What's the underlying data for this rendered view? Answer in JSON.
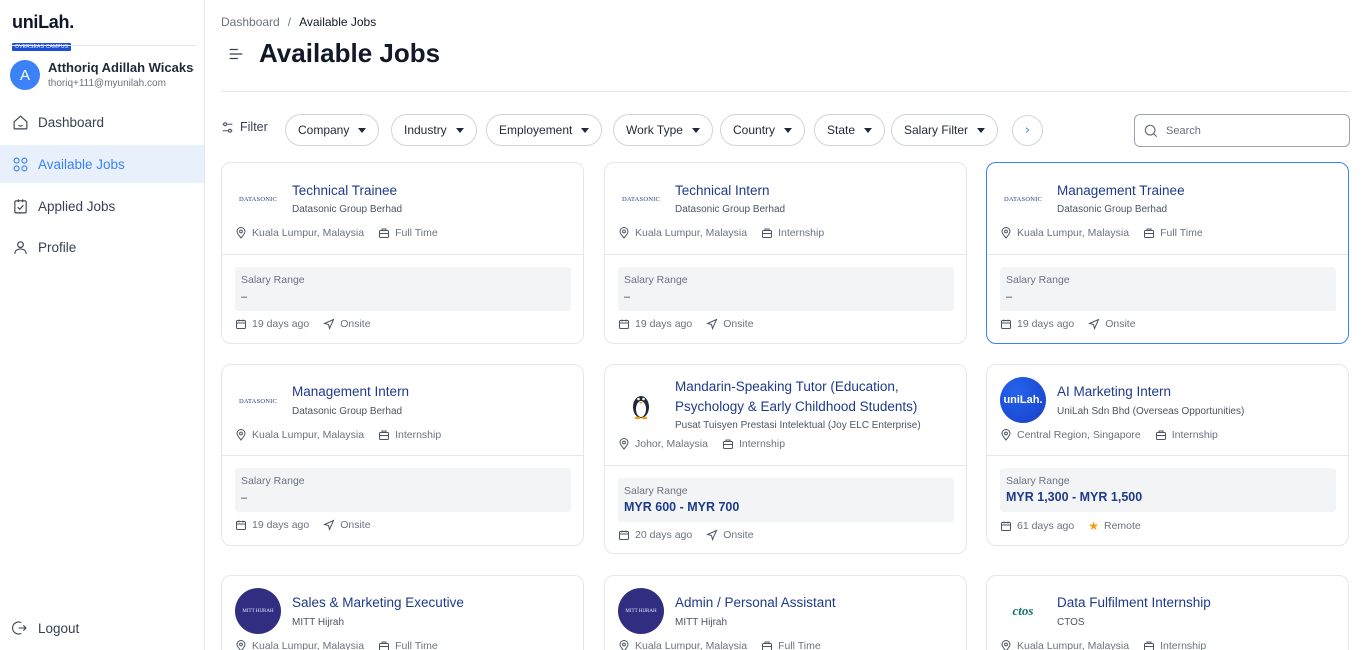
{
  "brand": {
    "name": "uniLah.",
    "tagline": "OVERSEAS CAMPUS"
  },
  "user": {
    "initial": "A",
    "name": "Atthoriq Adillah Wicaksana",
    "email": "thoriq+111@myunilah.com"
  },
  "sidebar": {
    "items": [
      {
        "label": "Dashboard",
        "icon": "home-icon",
        "active": false
      },
      {
        "label": "Available Jobs",
        "icon": "grid-icon",
        "active": true
      },
      {
        "label": "Applied Jobs",
        "icon": "applied-icon",
        "active": false
      },
      {
        "label": "Profile",
        "icon": "person-icon",
        "active": false
      }
    ],
    "logout": "Logout"
  },
  "breadcrumb": {
    "root": "Dashboard",
    "separator": "/",
    "current": "Available Jobs"
  },
  "page": {
    "title": "Available Jobs"
  },
  "filters": {
    "label": "Filter",
    "dropdowns": [
      "Company",
      "Industry",
      "Employement",
      "Work Type",
      "Country",
      "State",
      "Salary Filter"
    ],
    "next": "›"
  },
  "search": {
    "placeholder": "Search"
  },
  "common": {
    "salary_label": "Salary Range"
  },
  "colors": {
    "accent": "#3b82f6",
    "title": "#1e3a8a",
    "active_bg": "#e8f0fb"
  },
  "jobs": [
    {
      "title": "Technical Trainee",
      "company": "Datasonic Group Berhad",
      "logo": "DATASONIC",
      "location": "Kuala Lumpur, Malaysia",
      "type": "Full Time",
      "salary": "–",
      "posted": "19 days ago",
      "mode": "Onsite"
    },
    {
      "title": "Technical Intern",
      "company": "Datasonic Group Berhad",
      "logo": "DATASONIC",
      "location": "Kuala Lumpur, Malaysia",
      "type": "Internship",
      "salary": "–",
      "posted": "19 days ago",
      "mode": "Onsite"
    },
    {
      "title": "Management Trainee",
      "company": "Datasonic Group Berhad",
      "logo": "DATASONIC",
      "location": "Kuala Lumpur, Malaysia",
      "type": "Full Time",
      "salary": "–",
      "posted": "19 days ago",
      "mode": "Onsite"
    },
    {
      "title": "Management Intern",
      "company": "Datasonic Group Berhad",
      "logo": "DATASONIC",
      "location": "Kuala Lumpur, Malaysia",
      "type": "Internship",
      "salary": "–",
      "posted": "19 days ago",
      "mode": "Onsite"
    },
    {
      "title": "Mandarin-Speaking Tutor (Education, Psychology & Early Childhood Students)",
      "company": "Pusat Tuisyen Prestasi Intelektual (Joy ELC Enterprise)",
      "logo": "penguin",
      "location": "Johor, Malaysia",
      "type": "Internship",
      "salary": "MYR 600 - MYR 700",
      "posted": "20 days ago",
      "mode": "Onsite"
    },
    {
      "title": "AI Marketing Intern",
      "company": "UniLah Sdn Bhd (Overseas Opportunities)",
      "logo": "uniLah.",
      "location": "Central Region, Singapore",
      "type": "Internship",
      "salary": "MYR 1,300 - MYR 1,500",
      "posted": "61 days ago",
      "mode": "Remote"
    },
    {
      "title": "Sales & Marketing Executive",
      "company": "MITT Hijrah",
      "logo": "MITT HIJRAH",
      "location": "Kuala Lumpur, Malaysia",
      "type": "Full Time"
    },
    {
      "title": "Admin / Personal Assistant",
      "company": "MITT Hijrah",
      "logo": "MITT HIJRAH",
      "location": "Kuala Lumpur, Malaysia",
      "type": "Full Time"
    },
    {
      "title": "Data Fulfilment Internship",
      "company": "CTOS",
      "logo": "ctos",
      "location": "Kuala Lumpur, Malaysia",
      "type": "Internship"
    }
  ]
}
